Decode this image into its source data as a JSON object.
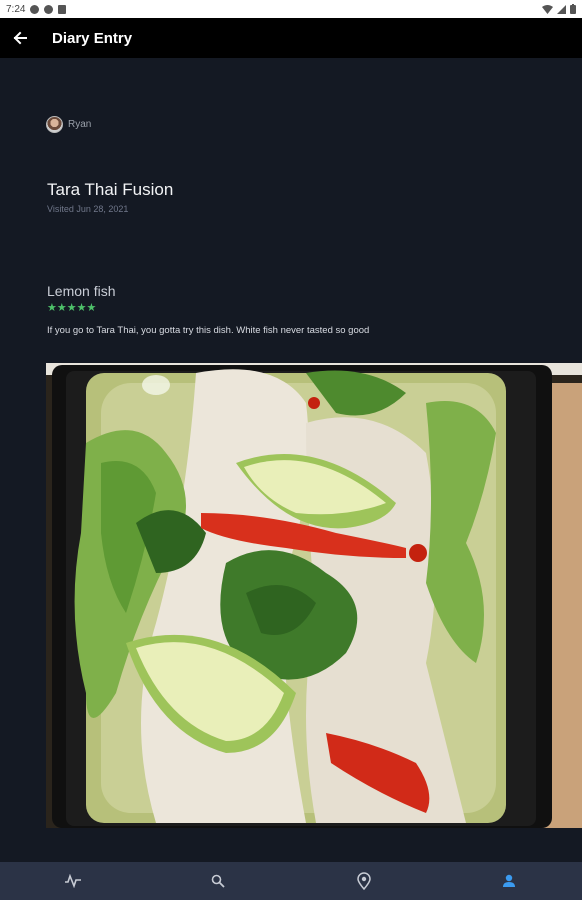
{
  "status_bar": {
    "time": "7:24"
  },
  "app_bar": {
    "title": "Diary Entry",
    "back_icon": "arrow-left-icon"
  },
  "entry": {
    "author": "Ryan",
    "restaurant": "Tara Thai Fusion",
    "visited": "Visited Jun 28, 2021",
    "dish": "Lemon fish",
    "rating": 5,
    "stars": "★★★★★",
    "review": "If you go to Tara Thai, you gotta try this dish. White fish never tasted so good"
  },
  "bottom_nav": {
    "items": [
      {
        "icon": "activity-icon"
      },
      {
        "icon": "search-icon"
      },
      {
        "icon": "location-pin-icon"
      },
      {
        "icon": "person-icon"
      }
    ],
    "active_index": 3
  },
  "colors": {
    "background": "#141923",
    "app_bar": "#000000",
    "nav": "#2b3346",
    "accent": "#3b9bf0",
    "stars": "#4ec26a"
  }
}
